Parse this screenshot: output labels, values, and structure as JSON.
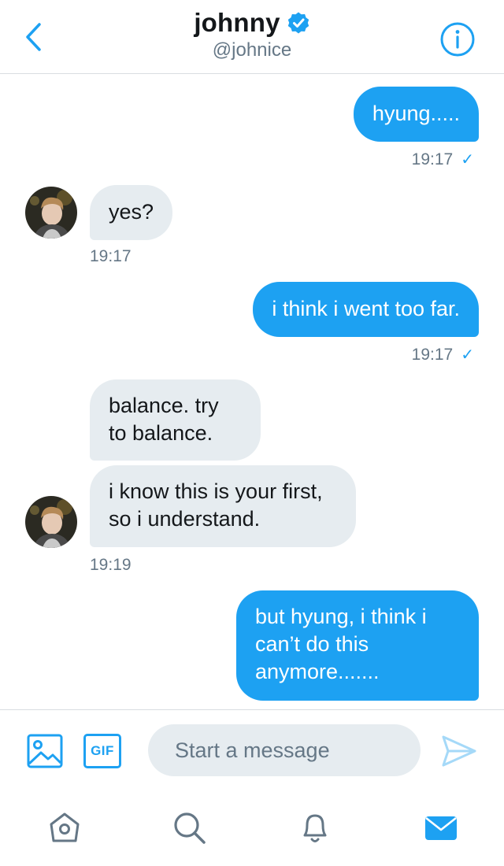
{
  "header": {
    "name": "johnny",
    "handle": "@johnice",
    "verified_icon": "verified-badge-icon",
    "back_icon": "chevron-left-icon",
    "info_icon": "info-circle-icon"
  },
  "messages": [
    {
      "direction": "out",
      "text": "hyung.....",
      "time": "19:17",
      "status": "✓"
    },
    {
      "direction": "in",
      "text": "yes?",
      "time": "19:17"
    },
    {
      "direction": "out",
      "text": "i think i went too far.",
      "time": "19:17",
      "status": "✓"
    },
    {
      "direction": "in",
      "text": "balance. try to balance."
    },
    {
      "direction": "in",
      "text": "i know this is your first, so i understand.",
      "time": "19:19"
    },
    {
      "direction": "out",
      "text": "but hyung, i think i can’t do this anymore......."
    }
  ],
  "composer": {
    "placeholder": "Start a message",
    "gif_label": "GIF",
    "image_icon": "image-icon",
    "send_icon": "send-icon"
  },
  "tabbar": {
    "items": [
      "home-icon",
      "search-icon",
      "bell-icon",
      "mail-icon"
    ],
    "active": "mail-icon"
  },
  "colors": {
    "accent": "#1da1f2",
    "incoming_bubble": "#e6ecf0",
    "secondary_text": "#657786"
  }
}
